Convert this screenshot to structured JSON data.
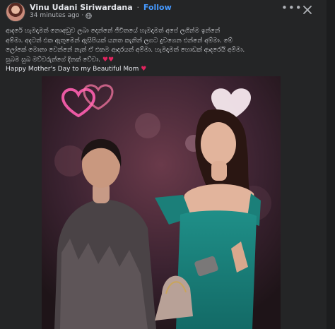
{
  "post": {
    "author": "Vinu Udani Siriwardana",
    "separator": "·",
    "follow_label": "Follow",
    "timestamp": "34 minutes ago",
    "meta_separator": "·",
    "privacy_icon": "globe-icon",
    "more_icon": "ellipsis-icon",
    "close_icon": "close-icon",
    "text_lines": [
      "ආදරේ හැමදාමත් නොඅඩුව ලබා දෙන්නේ ජීවිතයේ හැමදාමත් අපේ ලගින්ම ඉන්නේ",
      "අම්මා. අදටත් එක ඇතුමෙන් ඇසිපියක් යනත කැනින් ලගට දුවගෙන එන්නේ අම්මා. මේ",
      "ලෝකේ මොනා වෙන්නේ නැත් ඒ එකම ආදරයත් අම්මා. හැමදාමත් හොඩක් ආදරෙයි අම්මා.",
      "සුබම සුබ මව්වරුන්ගේ දිනක් වේවා."
    ],
    "hearts": "♥♥",
    "english_line": "Happy Mother's Day to my Beautiful Mom",
    "english_heart": "♥"
  },
  "colors": {
    "background": "#242526",
    "text": "#e4e6eb",
    "secondary_text": "#b0b3b8",
    "link": "#4599ff",
    "heart": "#e0245e"
  }
}
